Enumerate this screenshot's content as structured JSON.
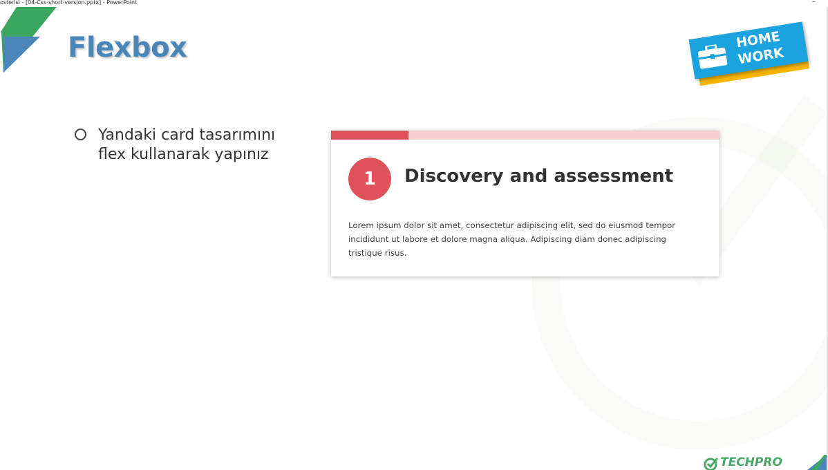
{
  "window": {
    "title": "osterisi - [04-Css-short-version.pptx] - PowerPoint",
    "minimize_label": "–"
  },
  "slide": {
    "title": "Flexbox",
    "homework_badge": {
      "line1": "HOME",
      "line2": "WORK",
      "icon": "briefcase-icon"
    },
    "bullet": "Yandaki card tasarımını flex kullanarak yapınız",
    "card": {
      "number": "1",
      "title": "Discovery and assessment",
      "body": "Lorem ipsum dolor sit amet, consectetur adipiscing elit, sed do eiusmod tempor incididunt ut labore et dolore magna aliqua. Adipiscing diam donec adipiscing tristique risus.",
      "progress": 0.2,
      "accent_color": "#e0525a",
      "track_color": "#f8cfd1"
    },
    "footer_logo_text": "TECHPRO"
  },
  "colors": {
    "title_blue": "#4a86b8",
    "badge_blue": "#1aa3de",
    "badge_yellow": "#f7b500",
    "corner_green": "#3aa65f",
    "corner_blue": "#4a86b8"
  }
}
